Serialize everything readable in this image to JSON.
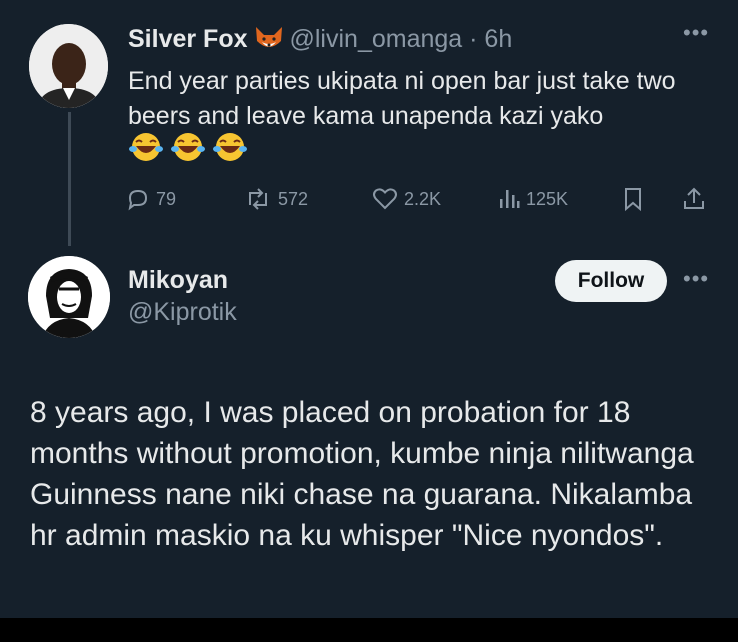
{
  "tweet1": {
    "display_name": "Silver Fox",
    "handle_time": "@livin_omanga · 6h",
    "text": "End year parties ukipata ni open bar just take two beers and leave kama unapenda kazi yako",
    "emojis": [
      "😂",
      "😂",
      "😂"
    ],
    "stats": {
      "replies": "79",
      "reposts": "572",
      "likes": "2.2K",
      "views": "125K"
    }
  },
  "tweet2": {
    "display_name": "Mikoyan",
    "handle": "@Kiprotik",
    "follow_label": "Follow",
    "text": "8 years ago, I was placed on probation for 18 months without promotion, kumbe ninja nilitwanga Guinness nane niki chase na guarana. Nikalamba hr admin maskio na ku whisper \"Nice nyondos\"."
  },
  "icons": {
    "more": "more-dots-icon",
    "reply": "reply-icon",
    "repost": "repost-icon",
    "like": "heart-icon",
    "views": "views-icon",
    "bookmark": "bookmark-icon",
    "share": "share-icon",
    "badge": "fox-emoji-icon"
  },
  "colors": {
    "background": "#15202b",
    "text": "#e7e9ea",
    "muted": "#8b98a5",
    "follow_bg": "#eff3f4"
  }
}
